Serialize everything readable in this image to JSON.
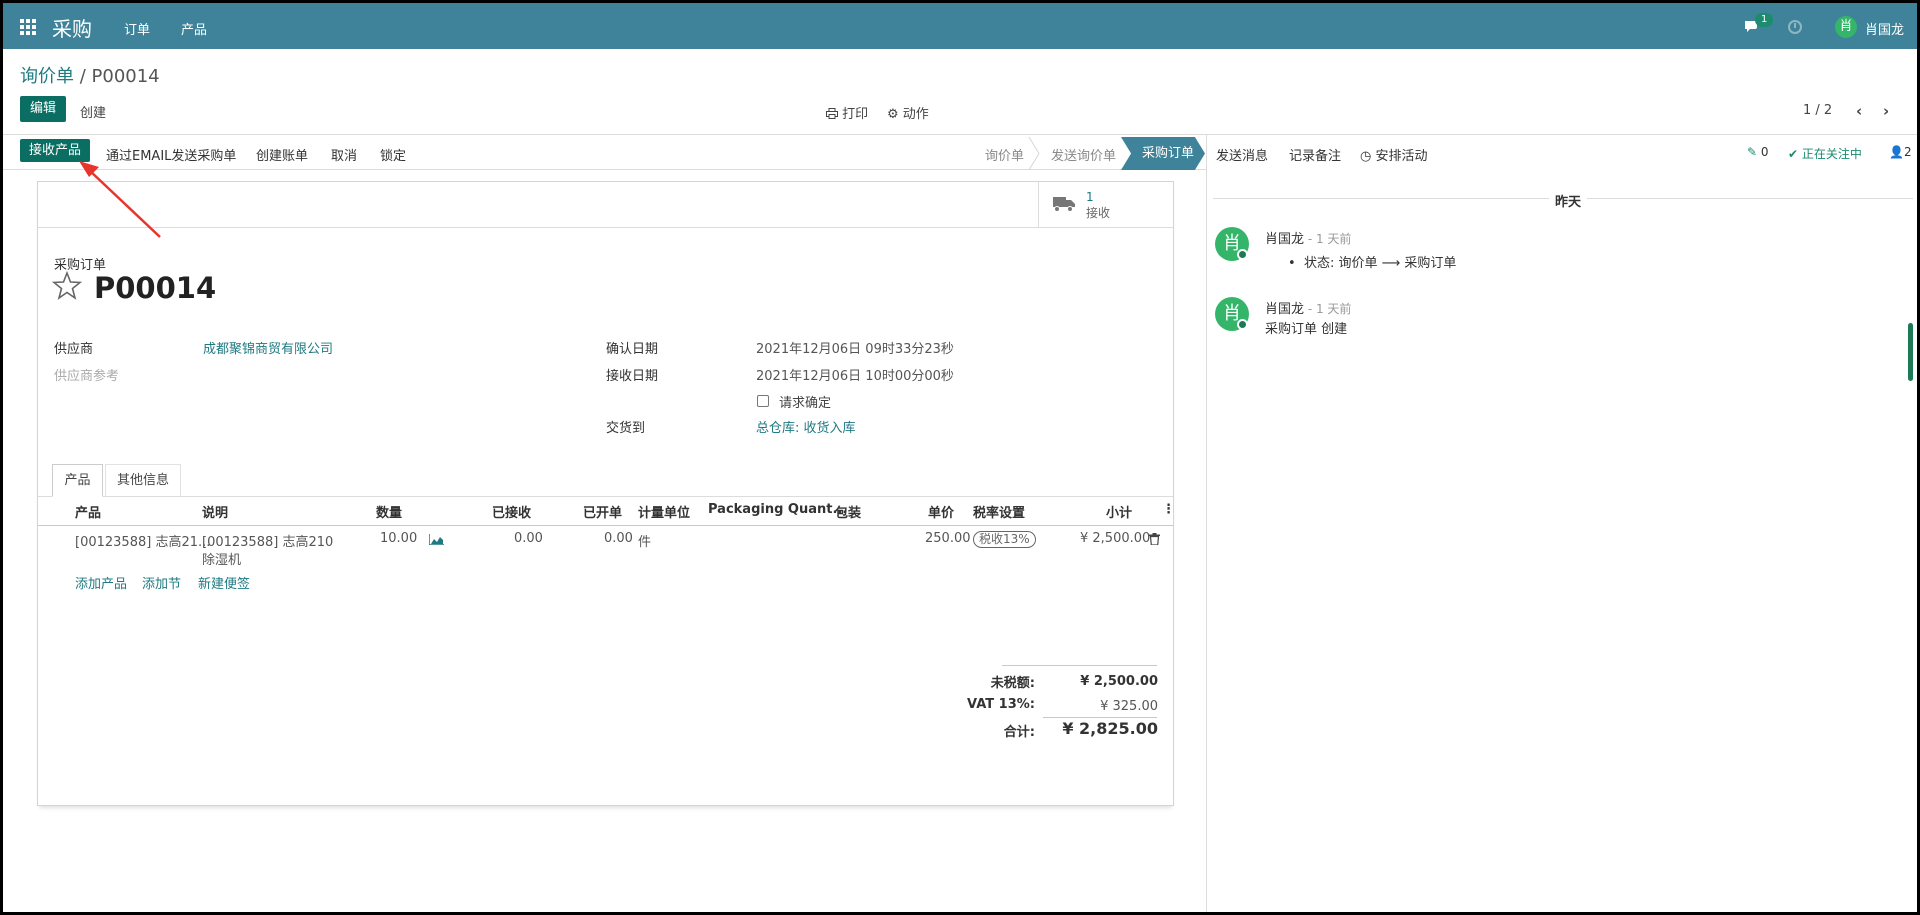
{
  "navbar": {
    "brand": "采购",
    "menu": [
      "订单",
      "产品"
    ],
    "chat_badge": "1",
    "user": "肖国龙",
    "user_initial": "肖"
  },
  "control": {
    "breadcrumb_parent": "询价单",
    "breadcrumb_sep": " / ",
    "breadcrumb_current": "P00014",
    "edit_label": "编辑",
    "create_label": "创建",
    "print_label": "打印",
    "action_label": "动作",
    "pager": "1 / 2"
  },
  "statusbar": {
    "buttons": [
      "接收产品",
      "通过EMAIL发送采购单",
      "创建账单",
      "取消",
      "锁定"
    ],
    "stages": [
      "询价单",
      "发送询价单",
      "采购订单"
    ],
    "active_stage": "采购订单"
  },
  "form": {
    "receipts_count": "1",
    "receipts_label": "接收",
    "doc_type": "采购订单",
    "doc_name": "P00014",
    "vendor_label": "供应商",
    "vendor_value": "成都聚锦商贸有限公司",
    "vendor_ref_label": "供应商参考",
    "confirm_date_label": "确认日期",
    "confirm_date_value": "2021年12月06日 09时33分23秒",
    "receipt_date_label": "接收日期",
    "receipt_date_value": "2021年12月06日 10时00分00秒",
    "ask_confirm_label": "请求确定",
    "deliver_to_label": "交货到",
    "deliver_to_value": "总仓库: 收货入库",
    "tabs": [
      "产品",
      "其他信息"
    ]
  },
  "lines": {
    "headers": {
      "product": "产品",
      "description": "说明",
      "qty": "数量",
      "received": "已接收",
      "billed": "已开单",
      "uom": "计量单位",
      "packaging_qty": "Packaging Quant...",
      "packaging": "包装",
      "price": "单价",
      "taxes": "税率设置",
      "subtotal": "小计"
    },
    "rows": [
      {
        "product": "[00123588] 志高21...",
        "description_1": "[00123588] 志高210",
        "description_2": "除湿机",
        "qty": "10.00",
        "received": "0.00",
        "billed": "0.00",
        "uom": "件",
        "price": "250.00",
        "tax": "税收13%",
        "subtotal": "¥ 2,500.00"
      }
    ],
    "add_product": "添加产品",
    "add_section": "添加节",
    "add_note": "新建便签"
  },
  "totals": {
    "untaxed_label": "未税额:",
    "untaxed_value": "¥ 2,500.00",
    "vat_label": "VAT 13%:",
    "vat_value": "¥ 325.00",
    "total_label": "合计:",
    "total_value": "¥ 2,825.00"
  },
  "chatter": {
    "send_message": "发送消息",
    "log_note": "记录备注",
    "schedule_activity": "安排活动",
    "attachments_count": "0",
    "following": "正在关注中",
    "followers_count": "2",
    "day_separator": "昨天",
    "messages": [
      {
        "author": "肖国龙",
        "ago": " - 1 天前",
        "body": "状态: 询价单 ⟶ 采购订单"
      },
      {
        "author": "肖国龙",
        "ago": " - 1 天前",
        "body": "采购订单 创建"
      }
    ]
  },
  "colors": {
    "navbar": "#3e8399",
    "primary": "#0b6e63",
    "link": "#1f7a82",
    "avatar": "#34b569"
  }
}
